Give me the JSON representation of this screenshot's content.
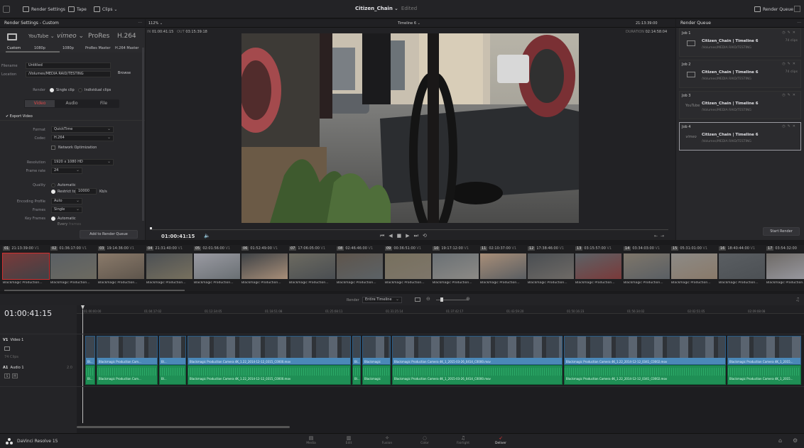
{
  "app": {
    "title": "Citizen_Chain",
    "title_status": "Edited",
    "render_settings_tab": "Render Settings",
    "tape_tab": "Tape",
    "clips_tab": "Clips",
    "render_queue_btn": "Render Queue",
    "product": "DaVinci Resolve 15"
  },
  "render_settings": {
    "header": "Render Settings - Custom",
    "presets": [
      {
        "name": "Custom",
        "sub": "Custom",
        "icon": "monitor-icon"
      },
      {
        "name": "YouTube",
        "sub": "1080p"
      },
      {
        "name": "vimeo",
        "sub": "1080p"
      },
      {
        "name": "ProRes",
        "sub": "ProRes Master"
      },
      {
        "name": "H.264",
        "sub": "H.264 Master"
      }
    ],
    "filename_label": "Filename",
    "filename_value": "Untitled",
    "location_label": "Location",
    "location_value": "/Volumes/MEDIA RAID/TESTING",
    "browse": "Browse",
    "render_label": "Render",
    "single_clip": "Single clip",
    "individual_clips": "Individual clips",
    "tabs": [
      "Video",
      "Audio",
      "File"
    ],
    "export_video": "Export Video",
    "format_label": "Format",
    "format_value": "QuickTime",
    "codec_label": "Codec",
    "codec_value": "H.264",
    "network_opt": "Network Optimization",
    "resolution_label": "Resolution",
    "resolution_value": "1920 x 1080 HD",
    "framerate_label": "Frame rate",
    "framerate_value": "24",
    "quality_label": "Quality",
    "quality_auto": "Automatic",
    "restrict_to": "Restrict to",
    "restrict_value": "10000",
    "restrict_unit": "Kb/s",
    "encoding_label": "Encoding Profile",
    "encoding_value": "Auto",
    "frames_label": "Frames",
    "frames_value": "Single",
    "keyframes_label": "Key Frames",
    "keyframes_auto": "Automatic",
    "keyframes_every": "Every",
    "keyframes_frames": "frames",
    "add_btn": "Add to Render Queue"
  },
  "viewer": {
    "zoom": "112%",
    "in_label": "IN",
    "in": "01:00:41:15",
    "out_label": "OUT",
    "out": "03:15:39:18",
    "timeline": "Timeline 6",
    "tc_top": "21:13:39:00",
    "duration_label": "DURATION",
    "duration": "02:14:58:04",
    "tc": "01:00:41:15"
  },
  "queue": {
    "header": "Render Queue",
    "start": "Start Render",
    "jobs": [
      {
        "job": "Job 1",
        "name": "Citizen_Chain | Timeline 6",
        "path": "/Volumes/MEDIA RAID/TESTING",
        "count": "74 clips",
        "icon": "monitor-icon",
        "icon_text": ""
      },
      {
        "job": "Job 2",
        "name": "Citizen_Chain | Timeline 6",
        "path": "/Volumes/MEDIA RAID/TESTING",
        "count": "74 clips",
        "icon": "monitor-icon",
        "icon_text": ""
      },
      {
        "job": "Job 3",
        "name": "Citizen_Chain | Timeline 6",
        "path": "/Volumes/MEDIA RAID/TESTING",
        "count": "",
        "icon": "youtube-icon",
        "icon_text": "YouTube"
      },
      {
        "job": "Job 4",
        "name": "Citizen_Chain | Timeline 6",
        "path": "/Volumes/MEDIA RAID/TESTING",
        "count": "",
        "icon": "vimeo-icon",
        "icon_text": "vimeo"
      }
    ]
  },
  "clips": [
    {
      "n": "01",
      "tc": "21:13:39:00",
      "v": "V1"
    },
    {
      "n": "02",
      "tc": "01:36:17:00",
      "v": "V1"
    },
    {
      "n": "03",
      "tc": "19:14:36:00",
      "v": "V1"
    },
    {
      "n": "04",
      "tc": "21:31:40:00",
      "v": "V1"
    },
    {
      "n": "05",
      "tc": "02:01:56:00",
      "v": "V1"
    },
    {
      "n": "06",
      "tc": "01:52:49:00",
      "v": "V1"
    },
    {
      "n": "07",
      "tc": "17:06:05:00",
      "v": "V1"
    },
    {
      "n": "08",
      "tc": "02:46:46:00",
      "v": "V1"
    },
    {
      "n": "09",
      "tc": "00:36:51:00",
      "v": "V1"
    },
    {
      "n": "10",
      "tc": "19:17:12:00",
      "v": "V1"
    },
    {
      "n": "11",
      "tc": "02:10:37:00",
      "v": "V1"
    },
    {
      "n": "12",
      "tc": "17:38:46:00",
      "v": "V1"
    },
    {
      "n": "13",
      "tc": "03:15:57:00",
      "v": "V1"
    },
    {
      "n": "14",
      "tc": "03:34:03:00",
      "v": "V1"
    },
    {
      "n": "15",
      "tc": "05:31:01:00",
      "v": "V1"
    },
    {
      "n": "16",
      "tc": "18:40:44:00",
      "v": "V1"
    },
    {
      "n": "17",
      "tc": "03:54:32:00",
      "v": ""
    }
  ],
  "clip_label": "Blackmagic Production...",
  "timeline": {
    "tc": "01:00:41:15",
    "render_label": "Render",
    "render_value": "Entire Timeline",
    "v1": "V1",
    "v1_name": "Video 1",
    "a1": "A1",
    "a1_name": "Audio 1",
    "a1_ch": "2.0",
    "clip_count": "74 Clips",
    "solo": "S",
    "mute": "M",
    "ruler": [
      "01:00:00:00",
      "01:04:17:02",
      "01:12:34:05",
      "01:18:51:08",
      "01:25:08:11",
      "01:31:25:14",
      "01:37:42:17",
      "01:43:59:20",
      "01:50:16:23",
      "01:56:34:02",
      "02:02:51:05",
      "02:09:08:08"
    ],
    "video_caps": [
      "Bl...",
      "Blackmagic Production Cam...",
      "Bl...",
      "Blackmagic Production Camera 4K_1.22_2014-12-12_0315_C0000.mov",
      "Bl...",
      "Blackmagic",
      "Blackmagic Production Camera 4K_1_2015-03-26_0414_C0000.mov",
      "Blackmagic Production Camera 4K_1.22_2014-12-12_0341_C0002.mov",
      "Blackmagic Production Camera 4K_1_2015..."
    ],
    "audio_caps": [
      "Bl...",
      "Blackmagic Production Cam...",
      "Bl...",
      "Blackmagic Production Camera 4K_1.22_2014-12-12_0315_C0000.mov",
      "Bl...",
      "Blackmagic",
      "Blackmagic Production Camera 4K_1_2015-03-26_0414_C0000.mov",
      "Blackmagic Production Camera 4K_1.22_2014-12-12_0341_C0002.mov",
      "Blackmagic Production Camera 4K_1_2015..."
    ]
  },
  "pages": [
    "Media",
    "Edit",
    "Fusion",
    "Color",
    "Fairlight",
    "Deliver"
  ],
  "colors": {
    "accent_red": "#c33a3a",
    "video_clip": "#4b88b8",
    "audio_clip": "#1f8f55"
  }
}
